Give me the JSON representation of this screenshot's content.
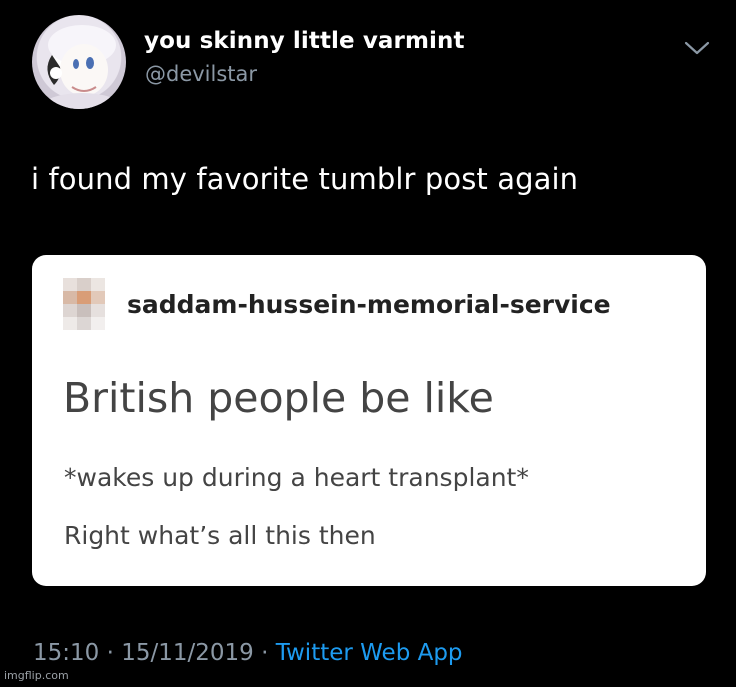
{
  "tweet": {
    "display_name": "you skinny little varmint",
    "handle": "@devilstar",
    "text": "i found my favorite tumblr post again",
    "time": "15:10",
    "separator1": " · ",
    "date": "15/11/2019",
    "separator2": " · ",
    "source_app": "Twitter Web App"
  },
  "tumblr_post": {
    "blog_name": "saddam-hussein-memorial-service",
    "title": "British people be like",
    "line1": "*wakes up during a heart transplant*",
    "line2": "Right what’s all this then"
  },
  "watermark": "imgflip.com",
  "icons": {
    "avatar": "avatar-icon",
    "menu": "chevron-down-icon",
    "blog_avatar": "blog-avatar-icon"
  },
  "colors": {
    "background": "#000000",
    "secondary_text": "#8b98a5",
    "link": "#1d9bf0",
    "card_background": "#ffffff"
  }
}
